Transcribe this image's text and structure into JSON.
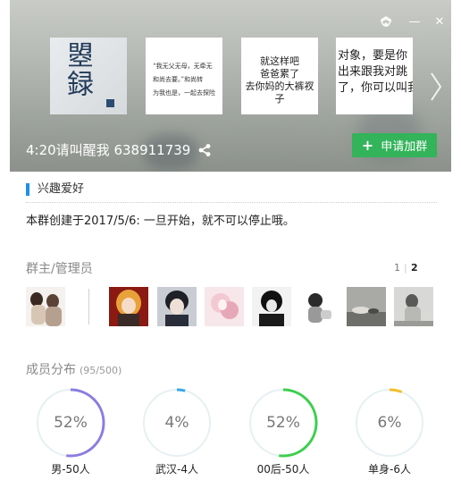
{
  "window_controls": {
    "settings_icon": "settings-icon",
    "minimize_icon": "minimize-icon",
    "close_icon": "close-icon",
    "minimize_glyph": "—",
    "close_glyph": "✕"
  },
  "banner": {
    "photos": [
      {
        "kind": "calligraphy",
        "text": "曌録"
      },
      {
        "kind": "text",
        "lines": [
          "“我无父无母，无牵无",
          "和尚去要。”和尚转",
          "为我也是，一起去探险"
        ]
      },
      {
        "kind": "text",
        "lines": [
          "就这样吧",
          "爸爸累了",
          "去你妈的大裤衩子"
        ]
      },
      {
        "kind": "text",
        "lines": [
          "对象，要是你",
          "出来跟我对跳",
          "了，你可以叫我"
        ]
      }
    ],
    "group_name": "4:20请叫醒我 638911739",
    "apply_button": "申请加群",
    "apply_plus": "+"
  },
  "interests": {
    "title": "兴趣爱好",
    "intro": "本群创建于2017/5/6:  一旦开始，就不可以停止哦。"
  },
  "admins": {
    "title": "群主/管理员",
    "page_current": "2",
    "page_other": "1",
    "count": 9
  },
  "distribution": {
    "title": "成员分布",
    "count": "(95/500)",
    "rings": [
      {
        "pct_text": "52%",
        "value": 0.52,
        "label": "男-50人",
        "color": "#8b7de0"
      },
      {
        "pct_text": "4%",
        "value": 0.04,
        "label": "武汉-4人",
        "color": "#3aa8e8"
      },
      {
        "pct_text": "52%",
        "value": 0.52,
        "label": "00后-50人",
        "color": "#3ccf4e"
      },
      {
        "pct_text": "6%",
        "value": 0.06,
        "label": "单身-6人",
        "color": "#f0c02a"
      }
    ],
    "track_color": "#e6f0f2"
  }
}
